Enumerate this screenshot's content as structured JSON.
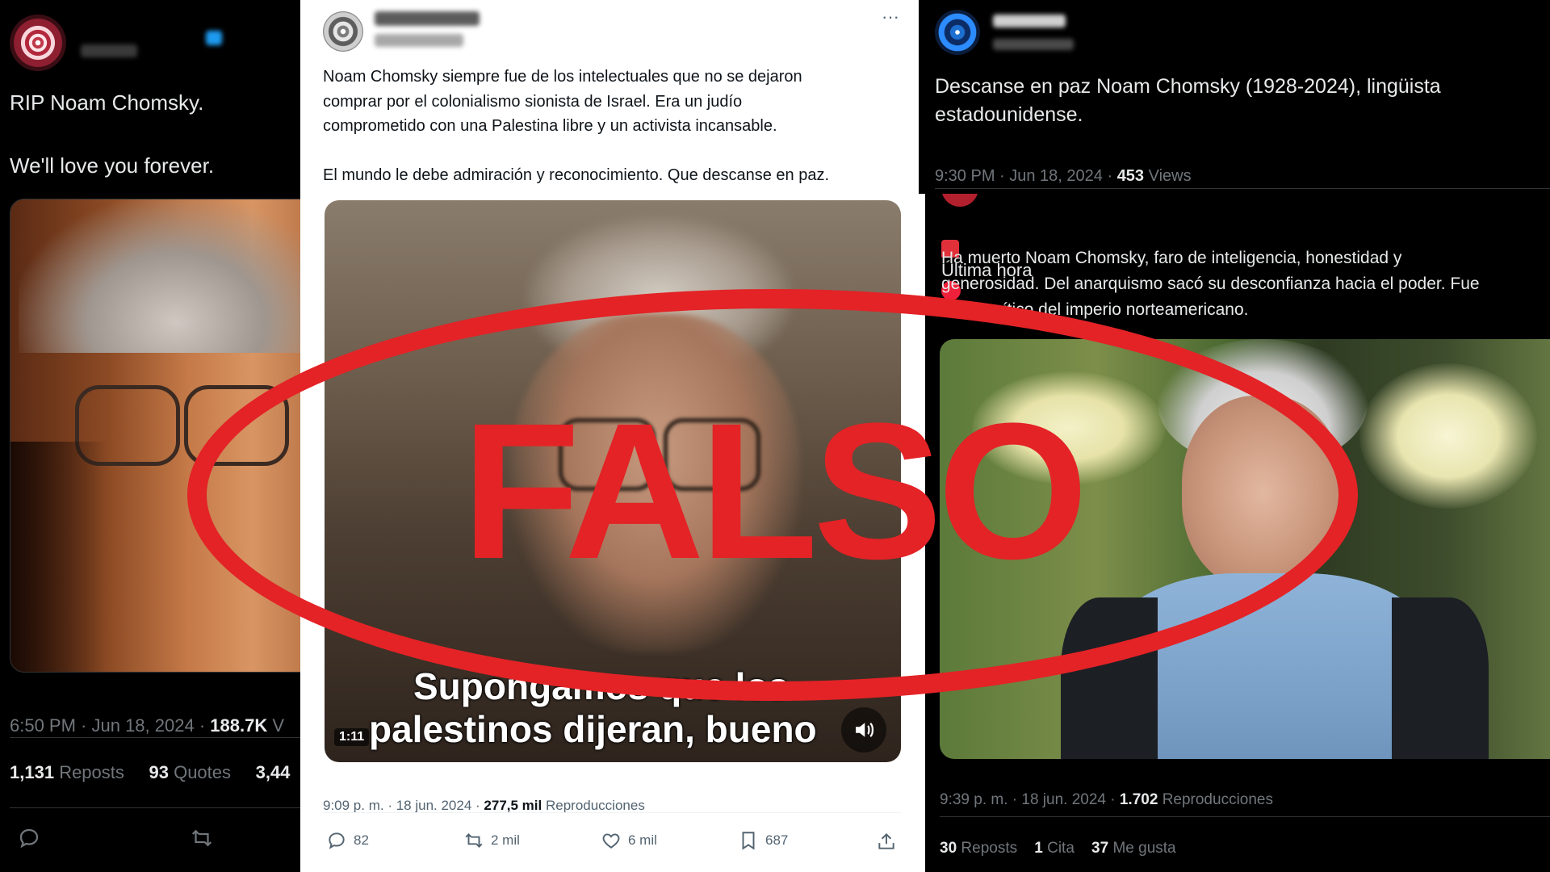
{
  "left_post": {
    "line1": "RIP Noam Chomsky.",
    "line2": "We'll love you forever.",
    "time": "6:50 PM · Jun 18, 2024 · ",
    "views_count": "188.7K",
    "views_label": "V",
    "reposts_count": "1,131",
    "reposts_label": "Reposts",
    "quotes_count": "93",
    "quotes_label": "Quotes",
    "likes_count": "3,44"
  },
  "center_post": {
    "body": "Noam Chomsky siempre fue de los intelectuales que no se dejaron\ncomprar por el colonialismo sionista de Israel. Era un judío\ncomprometido con una Palestina libre y un activista incansable.\n\nEl mundo le debe admiración y reconocimiento. Que descanse en paz.",
    "more_label": "···",
    "video_caption_line1": "Supongamos que los",
    "video_caption_line2": "palestinos dijeran, bueno",
    "video_duration": "1:11",
    "meta_time": "9:09 p. m. · 18 jun. 2024 · ",
    "meta_views_count": "277,5 mil",
    "meta_views_label": "Reproducciones",
    "replies": "82",
    "reposts": "2 mil",
    "likes": "6 mil",
    "bookmarks": "687"
  },
  "top_right_post": {
    "body": "Descanse en paz Noam Chomsky (1928-2024), lingüista\nestadounidense.",
    "time": "9:30 PM · Jun 18, 2024 · ",
    "views_count": "453",
    "views_label": "Views"
  },
  "bottom_right_post": {
    "header": "Última hora",
    "body": "Ha muerto Noam Chomsky, faro de inteligencia, honestidad y\ngenerosidad. Del anarquismo sacó su desconfianza hacia el poder. Fue\nmejor crítico del imperio norteamericano.",
    "meta_time": "9:39 p. m. · 18 jun. 2024 · ",
    "meta_views_count": "1.702",
    "meta_views_label": "Reproducciones",
    "reposts_count": "30",
    "reposts_label": "Reposts",
    "quotes_count": "1",
    "quotes_label": "Cita",
    "likes_count": "37",
    "likes_label": "Me gusta"
  },
  "stamp": {
    "text": "FALSO",
    "color": "#e32326"
  },
  "icons": [
    "reply-icon",
    "repost-icon",
    "like-icon",
    "bookmark-icon",
    "share-icon",
    "volume-icon",
    "siren-emoji",
    "red-circle-emoji",
    "more-icon"
  ]
}
